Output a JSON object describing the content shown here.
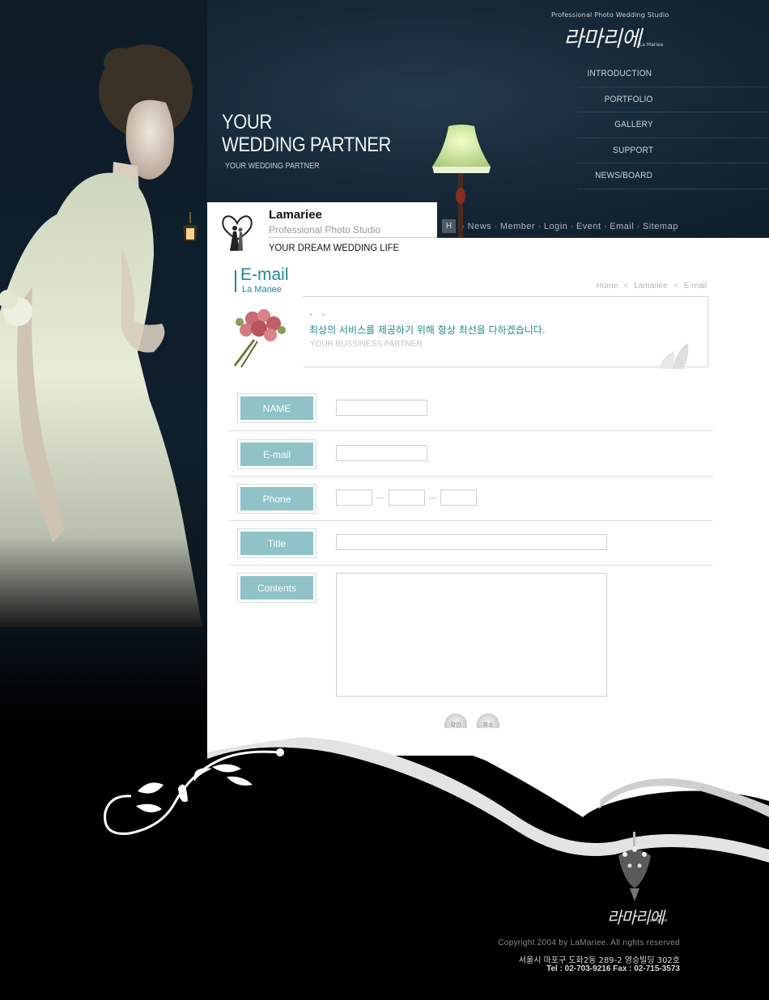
{
  "header": {
    "studio_subtitle": "Professional Photo Wedding Studio",
    "studio_logo": "라마리에",
    "studio_logo_small": "La Mariee",
    "nav": [
      "INTRODUCTION",
      "PORTFOLIO",
      "GALLERY",
      "SUPPORT",
      "NEWS/BOARD"
    ],
    "tagline_line1": "YOUR",
    "tagline_line2": "WEDDING PARTNER",
    "tagline_small": "YOUR WEDDING PARTNER",
    "quick_home": "H",
    "quick_menu": [
      "News",
      "Member",
      "Login",
      "Event",
      "Email",
      "Sitemap"
    ]
  },
  "brand": {
    "name": "Lamariee",
    "subtitle": "Professional Photo Studio",
    "slogan": "YOUR DREAM WEDDING LIFE"
  },
  "section": {
    "title": "E-mail",
    "subtitle": "La Mariee",
    "breadcrumb": [
      "Home",
      "<",
      "Lamariee",
      "<",
      "E-mail"
    ]
  },
  "welcome": {
    "dots": "• •",
    "message": "최상의 서비스를 제공하기 위해 항상 최선을 다하겠습니다.",
    "sub": "YOUR BUSSINESS PARTNER"
  },
  "form": {
    "name_label": "NAME",
    "email_label": "E-mail",
    "phone_label": "Phone",
    "title_label": "Title",
    "contents_label": "Contents",
    "name_value": "",
    "email_value": "",
    "phone_values": [
      "",
      "",
      ""
    ],
    "title_value": "",
    "contents_value": "",
    "confirm_button": "확인",
    "cancel_button": "취소"
  },
  "footer": {
    "logo": "라마리에",
    "logo_small": "La Mariee",
    "copyright": "Copyright 2004 by LaMariee. All rights reserved",
    "address": "서울시 마포구 도화2동 289-2 영승빌딩 302호",
    "tel": "Tel : 02-703-9216  Fax : 02-715-3573"
  },
  "colors": {
    "accent": "#1e8a93",
    "label_bg": "#8fc3c7",
    "header_bg": "#162838",
    "footer_bg": "#000000"
  }
}
